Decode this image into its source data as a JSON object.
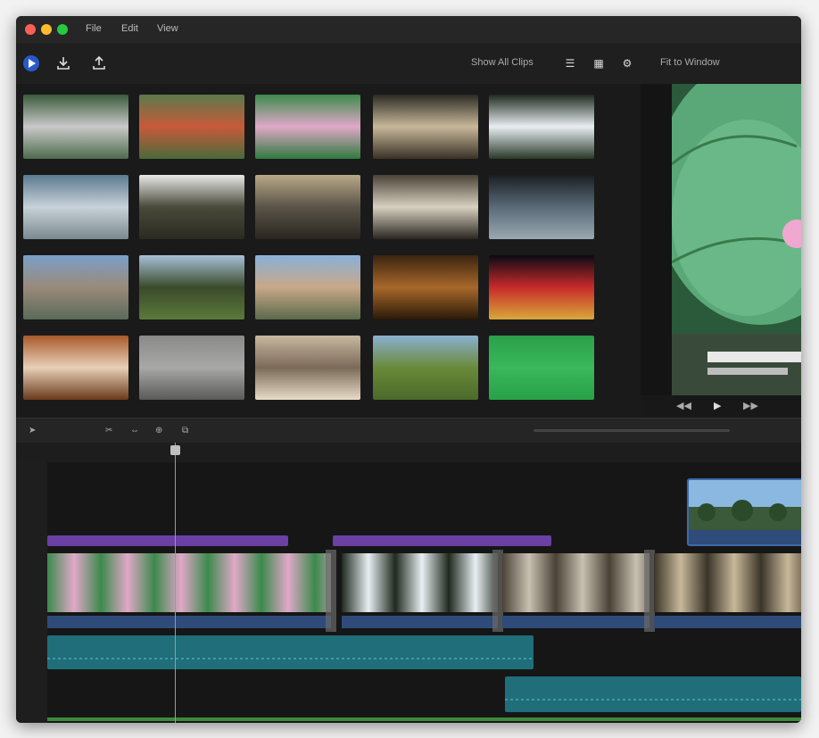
{
  "window": {
    "menu": [
      "File",
      "Edit",
      "View"
    ],
    "traffic_colors": [
      "#ff5f57",
      "#febc2e",
      "#28c840"
    ]
  },
  "toolbar": {
    "left_icons": [
      "app-logo-icon",
      "import-icon",
      "share-icon"
    ],
    "view_label": "Show All Clips",
    "right_label": "Fit to Window"
  },
  "media": {
    "clips": [
      {
        "label": "",
        "colors": [
          "#3a5a3a",
          "#c9c9c9",
          "#4d6b4d"
        ]
      },
      {
        "label": "",
        "colors": [
          "#5a7a4a",
          "#c85a3a",
          "#4a6a3a"
        ]
      },
      {
        "label": "",
        "colors": [
          "#3c8a4c",
          "#e0a8c8",
          "#2f7a3f"
        ]
      },
      {
        "label": "",
        "colors": [
          "#2a2a22",
          "#c8b89a",
          "#3a3226"
        ]
      },
      {
        "label": "",
        "colors": [
          "#1f2a1f",
          "#e8eef2",
          "#2a3a2a"
        ]
      },
      {
        "label": "",
        "colors": [
          "#5a7a90",
          "#c8d2d8",
          "#7a8a90"
        ]
      },
      {
        "label": "",
        "colors": [
          "#e8e8e8",
          "#4a4a3a",
          "#2a2a22"
        ]
      },
      {
        "label": "",
        "colors": [
          "#b8a888",
          "#5a5448",
          "#2a2620"
        ]
      },
      {
        "label": "",
        "colors": [
          "#4a4236",
          "#d8d0c0",
          "#2a2620"
        ]
      },
      {
        "label": "",
        "colors": [
          "#1a1e22",
          "#5a6a78",
          "#9aa8b0"
        ]
      },
      {
        "label": "",
        "colors": [
          "#7aa0c8",
          "#9a8a7a",
          "#5a6a5a"
        ]
      },
      {
        "label": "",
        "colors": [
          "#a8c0d8",
          "#3a4a2a",
          "#5a7a3a"
        ]
      },
      {
        "label": "",
        "colors": [
          "#8ab0d8",
          "#c8a888",
          "#5a6a4a"
        ]
      },
      {
        "label": "",
        "colors": [
          "#3a2410",
          "#a8682a",
          "#2a1a08"
        ]
      },
      {
        "label": "",
        "colors": [
          "#0a0a14",
          "#c82a2a",
          "#d8a83a"
        ]
      },
      {
        "label": "",
        "colors": [
          "#a85a2a",
          "#e8d0b8",
          "#6a3a1a"
        ]
      },
      {
        "label": "",
        "colors": [
          "#8a8a88",
          "#a8a8a6",
          "#5a5a58"
        ]
      },
      {
        "label": "",
        "colors": [
          "#c8b8a0",
          "#7a6a58",
          "#e8dcc8"
        ]
      },
      {
        "label": "",
        "colors": [
          "#8ab0d0",
          "#6a8a3a",
          "#4a6a2a"
        ]
      },
      {
        "label": "",
        "colors": [
          "#2aa04a",
          "#3ab85a",
          "#28a048"
        ]
      }
    ]
  },
  "preview": {
    "controls": [
      "rewind-icon",
      "play-icon",
      "forward-icon"
    ]
  },
  "timeline": {
    "tool_icons": [
      "select-tool-icon",
      "cut-tool-icon",
      "trim-tool-icon",
      "zoom-tool-icon",
      "snap-icon"
    ],
    "ruler_marks": [
      "",
      "",
      ""
    ],
    "title_clips": [
      {
        "label": ""
      },
      {
        "label": ""
      }
    ],
    "video_clips": [
      {
        "label": "",
        "colors": [
          "#3c8a4c",
          "#e0a8c8"
        ]
      },
      {
        "label": "",
        "colors": [
          "#1f2a1f",
          "#e8eef2"
        ]
      },
      {
        "label": "",
        "colors": [
          "#4a4236",
          "#c8c0b0"
        ]
      },
      {
        "label": "",
        "colors": [
          "#3a3428",
          "#c8b89a"
        ]
      }
    ],
    "audio_clips": [
      {
        "label": ""
      },
      {
        "label": ""
      }
    ],
    "overlay_clip": {
      "colors": [
        "#5a8ab8",
        "#3a5a3a"
      ]
    }
  }
}
